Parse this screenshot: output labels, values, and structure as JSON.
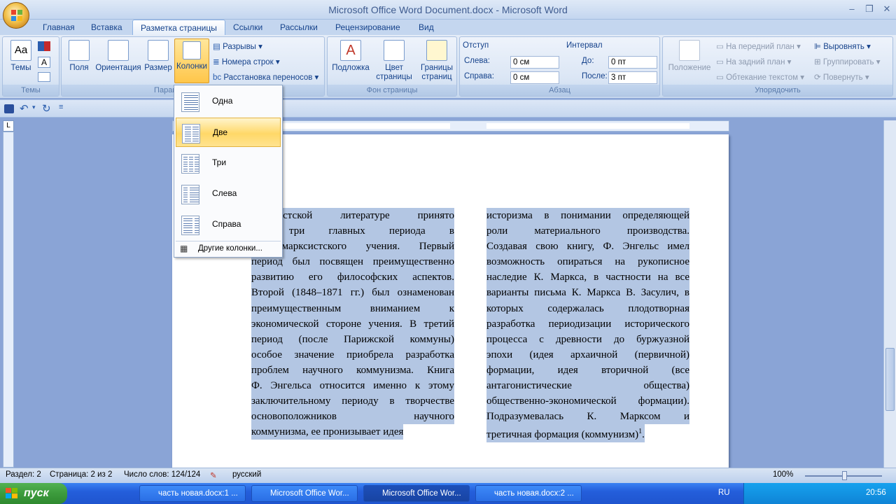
{
  "window": {
    "title": "Microsoft Office Word Document.docx - Microsoft Word"
  },
  "tabs": [
    "Главная",
    "Вставка",
    "Разметка страницы",
    "Ссылки",
    "Рассылки",
    "Рецензирование",
    "Вид"
  ],
  "active_tab": "Разметка страницы",
  "ribbon": {
    "themes": {
      "label": "Темы",
      "group": "Темы"
    },
    "page_setup": {
      "fields": "Поля",
      "orientation": "Ориентация",
      "size": "Размер",
      "columns": "Колонки",
      "breaks": "Разрывы",
      "line_numbers": "Номера строк",
      "hyphenation": "Расстановка переносов",
      "group": "Параметры страницы"
    },
    "background": {
      "watermark": "Подложка",
      "page_color": "Цвет страницы",
      "borders": "Границы страниц",
      "group": "Фон страницы"
    },
    "paragraph": {
      "indent_title": "Отступ",
      "left_label": "Слева:",
      "left_value": "0 см",
      "right_label": "Справа:",
      "right_value": "0 см",
      "spacing_title": "Интервал",
      "before_label": "До:",
      "before_value": "0 пт",
      "after_label": "После:",
      "after_value": "3 пт",
      "group": "Абзац"
    },
    "arrange": {
      "position": "Положение",
      "front": "На передний план",
      "back": "На задний план",
      "wrap": "Обтекание текстом",
      "align": "Выровнять",
      "group_btn": "Группировать",
      "rotate": "Повернуть",
      "group": "Упорядочить"
    }
  },
  "columns_menu": {
    "items": [
      "Одна",
      "Две",
      "Три",
      "Слева",
      "Справа"
    ],
    "selected": "Две",
    "more": "Другие колонки..."
  },
  "document": {
    "col1": [
      "марксистской литературе принято",
      "ать три главных периода в",
      "ии марксистского учения. Первый",
      "период был посвящен преимущественно",
      "развитию его философских аспектов.",
      "Второй (1848–1871 гг.) был ознаменован",
      "преимущественным вниманием к",
      "экономической стороне учения. В третий",
      "период (после Парижской коммуны)",
      "особое значение приобрела разработка",
      "проблем научного коммунизма. Книга",
      "Ф. Энгельса относится именно к этому",
      "заключительному периоду в творчестве",
      "основоположников научного",
      "коммунизма, ее пронизывает идея"
    ],
    "col2": [
      "историзма в понимании определяющей",
      "роли материального производства.",
      "Создавая свою книгу, Ф. Энгельс имел",
      "возможность опираться на рукописное",
      "наследие К. Маркса, в частности на все",
      "варианты письма К. Маркса В. Засулич, в",
      "которых содержалась плодотворная",
      "разработка периодизации исторического",
      "процесса с древности до буржуазной",
      "эпохи (идея архаичной (первичной)",
      "формации, идея вторичной (все",
      "антагонистические общества)",
      "общественно-экономической формации).",
      "Подразумевалась К. Марксом и",
      "третичная формация (коммунизм)"
    ],
    "footnote_mark": "1"
  },
  "statusbar": {
    "section": "Раздел: 2",
    "page": "Страница: 2 из 2",
    "words": "Число слов: 124/124",
    "language": "русский",
    "zoom": "100%"
  },
  "taskbar": {
    "start": "пуск",
    "buttons": [
      "часть новая.docx:1 ...",
      "Microsoft Office Wor...",
      "Microsoft Office Wor...",
      "часть новая.docx:2 ..."
    ],
    "active_index": 2,
    "lang": "RU",
    "clock": "20:56"
  }
}
